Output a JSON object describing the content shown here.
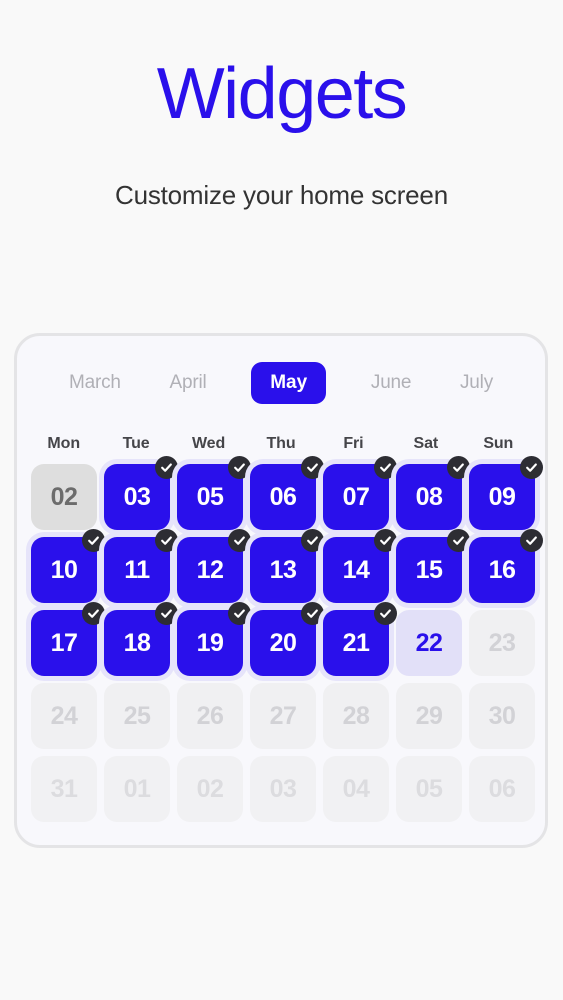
{
  "header": {
    "title": "Widgets",
    "subtitle": "Customize your home screen"
  },
  "colors": {
    "accent": "#2a10eb",
    "page_background": "#f9f9f9",
    "card_background": "#f8f8fc",
    "card_border": "#e4e4e6",
    "badge_background": "#2d2d33",
    "today_background": "#e2e0f8",
    "past_background": "#dedede",
    "muted_background": "#f0f0f2",
    "selected_halo": "#e6e4fa",
    "weekday_text": "#454549",
    "inactive_month_text": "#b0b0b6",
    "subtitle_text": "#333333"
  },
  "calendar": {
    "months": [
      {
        "label": "March",
        "selected": false
      },
      {
        "label": "April",
        "selected": false
      },
      {
        "label": "May",
        "selected": true
      },
      {
        "label": "June",
        "selected": false
      },
      {
        "label": "July",
        "selected": false
      }
    ],
    "weekdays": [
      "Mon",
      "Tue",
      "Wed",
      "Thu",
      "Fri",
      "Sat",
      "Sun"
    ],
    "check_icon": "check-icon",
    "days": [
      {
        "label": "02",
        "state": "past",
        "checked": false
      },
      {
        "label": "03",
        "state": "selected",
        "checked": true
      },
      {
        "label": "05",
        "state": "selected",
        "checked": true
      },
      {
        "label": "06",
        "state": "selected",
        "checked": true
      },
      {
        "label": "07",
        "state": "selected",
        "checked": true
      },
      {
        "label": "08",
        "state": "selected",
        "checked": true
      },
      {
        "label": "09",
        "state": "selected",
        "checked": true
      },
      {
        "label": "10",
        "state": "selected",
        "checked": true
      },
      {
        "label": "11",
        "state": "selected",
        "checked": true
      },
      {
        "label": "12",
        "state": "selected",
        "checked": true
      },
      {
        "label": "13",
        "state": "selected",
        "checked": true
      },
      {
        "label": "14",
        "state": "selected",
        "checked": true
      },
      {
        "label": "15",
        "state": "selected",
        "checked": true
      },
      {
        "label": "16",
        "state": "selected",
        "checked": true
      },
      {
        "label": "17",
        "state": "selected",
        "checked": true
      },
      {
        "label": "18",
        "state": "selected",
        "checked": true
      },
      {
        "label": "19",
        "state": "selected",
        "checked": true
      },
      {
        "label": "20",
        "state": "selected",
        "checked": true
      },
      {
        "label": "21",
        "state": "selected",
        "checked": true
      },
      {
        "label": "22",
        "state": "today",
        "checked": false
      },
      {
        "label": "23",
        "state": "muted",
        "checked": false
      },
      {
        "label": "24",
        "state": "muted",
        "checked": false
      },
      {
        "label": "25",
        "state": "muted",
        "checked": false
      },
      {
        "label": "26",
        "state": "muted",
        "checked": false
      },
      {
        "label": "27",
        "state": "muted",
        "checked": false
      },
      {
        "label": "28",
        "state": "muted",
        "checked": false
      },
      {
        "label": "29",
        "state": "muted",
        "checked": false
      },
      {
        "label": "30",
        "state": "muted",
        "checked": false
      },
      {
        "label": "31",
        "state": "faded",
        "checked": false
      },
      {
        "label": "01",
        "state": "faded",
        "checked": false
      },
      {
        "label": "02",
        "state": "faded",
        "checked": false
      },
      {
        "label": "03",
        "state": "faded",
        "checked": false
      },
      {
        "label": "04",
        "state": "faded",
        "checked": false
      },
      {
        "label": "05",
        "state": "faded",
        "checked": false
      },
      {
        "label": "06",
        "state": "faded",
        "checked": false
      }
    ]
  }
}
